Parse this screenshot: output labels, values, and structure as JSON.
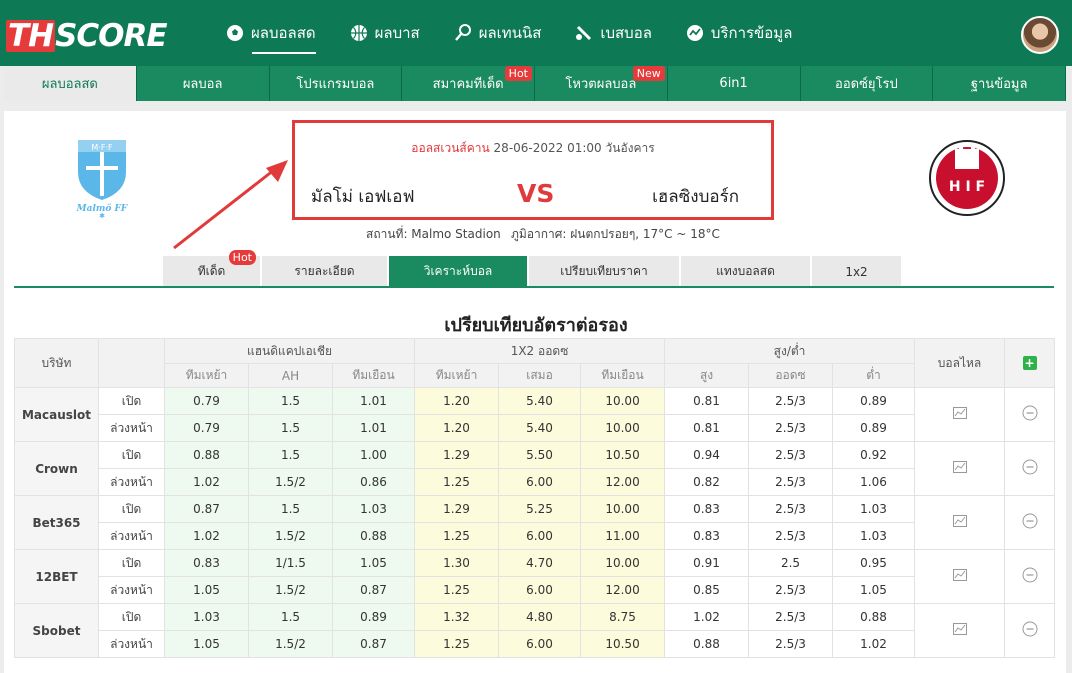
{
  "brand": {
    "part1": "TH",
    "part2": "SCORE"
  },
  "mainnav": [
    {
      "label": "ผลบอลสด",
      "icon": "football-icon"
    },
    {
      "label": "ผลบาส",
      "icon": "basketball-icon"
    },
    {
      "label": "ผลเทนนิส",
      "icon": "tennis-icon"
    },
    {
      "label": "เบสบอล",
      "icon": "baseball-icon"
    },
    {
      "label": "บริการข้อมูล",
      "icon": "data-service-icon"
    }
  ],
  "subnav": [
    {
      "label": "ผลบอลสด"
    },
    {
      "label": "ผลบอล"
    },
    {
      "label": "โปรแกรมบอล"
    },
    {
      "label": "สมาคมทีเด็ด",
      "badge": "Hot"
    },
    {
      "label": "โหวตผลบอล",
      "badge": "New"
    },
    {
      "label": "6in1"
    },
    {
      "label": "ออดซ์ยุโรป"
    },
    {
      "label": "ฐานข้อมูล"
    }
  ],
  "match": {
    "league": "ออลสเวนส์คาน",
    "datetime": "28-06-2022 01:00 วันอังคาร",
    "home": "มัลโม่ เอฟเอฟ",
    "vs": "VS",
    "away": "เฮลซิงบอร์ก",
    "venue": "สถานที่: Malmo Stadion",
    "weather": "ภูมิอากาศ: ฝนตกปรอยๆ, 17°C ~ 18°C",
    "home_logo_text": "M·F·F",
    "home_logo_caption": "Malmö FF",
    "away_logo_text": "H I F"
  },
  "tabs": [
    {
      "label": "ทีเด็ด",
      "badge": "Hot"
    },
    {
      "label": "รายละเอียด"
    },
    {
      "label": "วิเคราะห์บอล"
    },
    {
      "label": "เปรียบเทียบราคา"
    },
    {
      "label": "แทงบอลสด"
    },
    {
      "label": "1x2"
    }
  ],
  "section_title": "เปรียบเทียบอัตราต่อรอง",
  "table": {
    "col_company": "บริษัท",
    "group_ah": "แฮนดิแคปเอเชีย",
    "group_1x2": "1X2 ออดซ",
    "group_ou": "สูง/ต่ำ",
    "col_trend": "บอลไหล",
    "sub_ah": [
      "ทีมเหย้า",
      "AH",
      "ทีมเยือน"
    ],
    "sub_1x2": [
      "ทีมเหย้า",
      "เสมอ",
      "ทีมเยือน"
    ],
    "sub_ou": [
      "สูง",
      "ออดซ",
      "ต่ำ"
    ],
    "add_label": "+",
    "rows": [
      {
        "company": "Macauslot",
        "open": {
          "kind": "เปิด",
          "ah": [
            "0.79",
            "1.5",
            "1.01"
          ],
          "x12": [
            "1.20",
            "5.40",
            "10.00"
          ],
          "ou": [
            "0.81",
            "2.5/3",
            "0.89"
          ]
        },
        "live": {
          "kind": "ล่วงหน้า",
          "ah": [
            "0.79",
            "1.5",
            "1.01"
          ],
          "x12": [
            "1.20",
            "5.40",
            "10.00"
          ],
          "ou": [
            "0.81",
            "2.5/3",
            "0.89"
          ]
        }
      },
      {
        "company": "Crown",
        "open": {
          "kind": "เปิด",
          "ah": [
            "0.88",
            "1.5",
            "1.00"
          ],
          "x12": [
            "1.29",
            "5.50",
            "10.50"
          ],
          "ou": [
            "0.94",
            "2.5/3",
            "0.92"
          ]
        },
        "live": {
          "kind": "ล่วงหน้า",
          "ah": [
            "1.02",
            "1.5/2",
            "0.86"
          ],
          "x12": [
            "1.25",
            "6.00",
            "12.00"
          ],
          "ou": [
            "0.82",
            "2.5/3",
            "1.06"
          ]
        }
      },
      {
        "company": "Bet365",
        "open": {
          "kind": "เปิด",
          "ah": [
            "0.87",
            "1.5",
            "1.03"
          ],
          "x12": [
            "1.29",
            "5.25",
            "10.00"
          ],
          "ou": [
            "0.83",
            "2.5/3",
            "1.03"
          ]
        },
        "live": {
          "kind": "ล่วงหน้า",
          "ah": [
            "1.02",
            "1.5/2",
            "0.88"
          ],
          "x12": [
            "1.25",
            "6.00",
            "11.00"
          ],
          "ou": [
            "0.83",
            "2.5/3",
            "1.03"
          ]
        }
      },
      {
        "company": "12BET",
        "open": {
          "kind": "เปิด",
          "ah": [
            "0.83",
            "1/1.5",
            "1.05"
          ],
          "x12": [
            "1.30",
            "4.70",
            "10.00"
          ],
          "ou": [
            "0.91",
            "2.5",
            "0.95"
          ]
        },
        "live": {
          "kind": "ล่วงหน้า",
          "ah": [
            "1.05",
            "1.5/2",
            "0.87"
          ],
          "x12": [
            "1.25",
            "6.00",
            "12.00"
          ],
          "ou": [
            "0.85",
            "2.5/3",
            "1.05"
          ]
        }
      },
      {
        "company": "Sbobet",
        "open": {
          "kind": "เปิด",
          "ah": [
            "1.03",
            "1.5",
            "0.89"
          ],
          "x12": [
            "1.32",
            "4.80",
            "8.75"
          ],
          "ou": [
            "1.02",
            "2.5/3",
            "0.88"
          ]
        },
        "live": {
          "kind": "ล่วงหน้า",
          "ah": [
            "1.05",
            "1.5/2",
            "0.87"
          ],
          "x12": [
            "1.25",
            "6.00",
            "10.50"
          ],
          "ou": [
            "0.88",
            "2.5/3",
            "1.02"
          ]
        }
      }
    ]
  },
  "colors": {
    "brand_green": "#0e7a55",
    "accent_red": "#e03a3a",
    "ah_bg": "#eefaf0",
    "x12_bg": "#fcfbdc"
  }
}
